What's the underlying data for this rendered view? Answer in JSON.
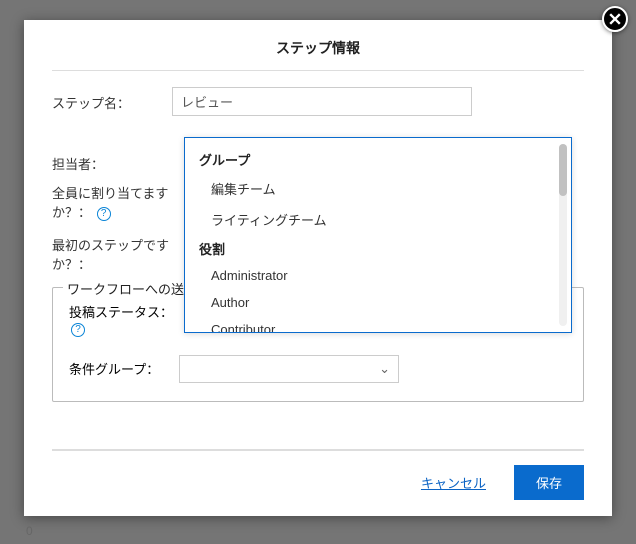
{
  "modal": {
    "title": "ステップ情報",
    "close_icon": "close"
  },
  "form": {
    "step_name_label": "ステップ名：",
    "step_name_value": "レビュー",
    "assignee_label": "担当者：",
    "assign_all_label_l1": "全員に割り当てます",
    "assign_all_label_l2": "か？：",
    "first_step_label_l1": "最初のステップです",
    "first_step_label_l2": "か？："
  },
  "dropdown": {
    "groups": [
      {
        "label": "グループ",
        "options": [
          "編集チーム",
          "ライティングチーム"
        ]
      },
      {
        "label": "役割",
        "options": [
          "Administrator",
          "Author",
          "Contributor"
        ]
      }
    ]
  },
  "fieldset": {
    "legend": "ワークフローへの送",
    "post_status_label": "投稿ステータス：",
    "condition_group_label": "条件グループ：",
    "condition_group_value": ""
  },
  "footer": {
    "cancel": "キャンセル",
    "save": "保存"
  },
  "misc": {
    "bottom_zero": "0"
  }
}
